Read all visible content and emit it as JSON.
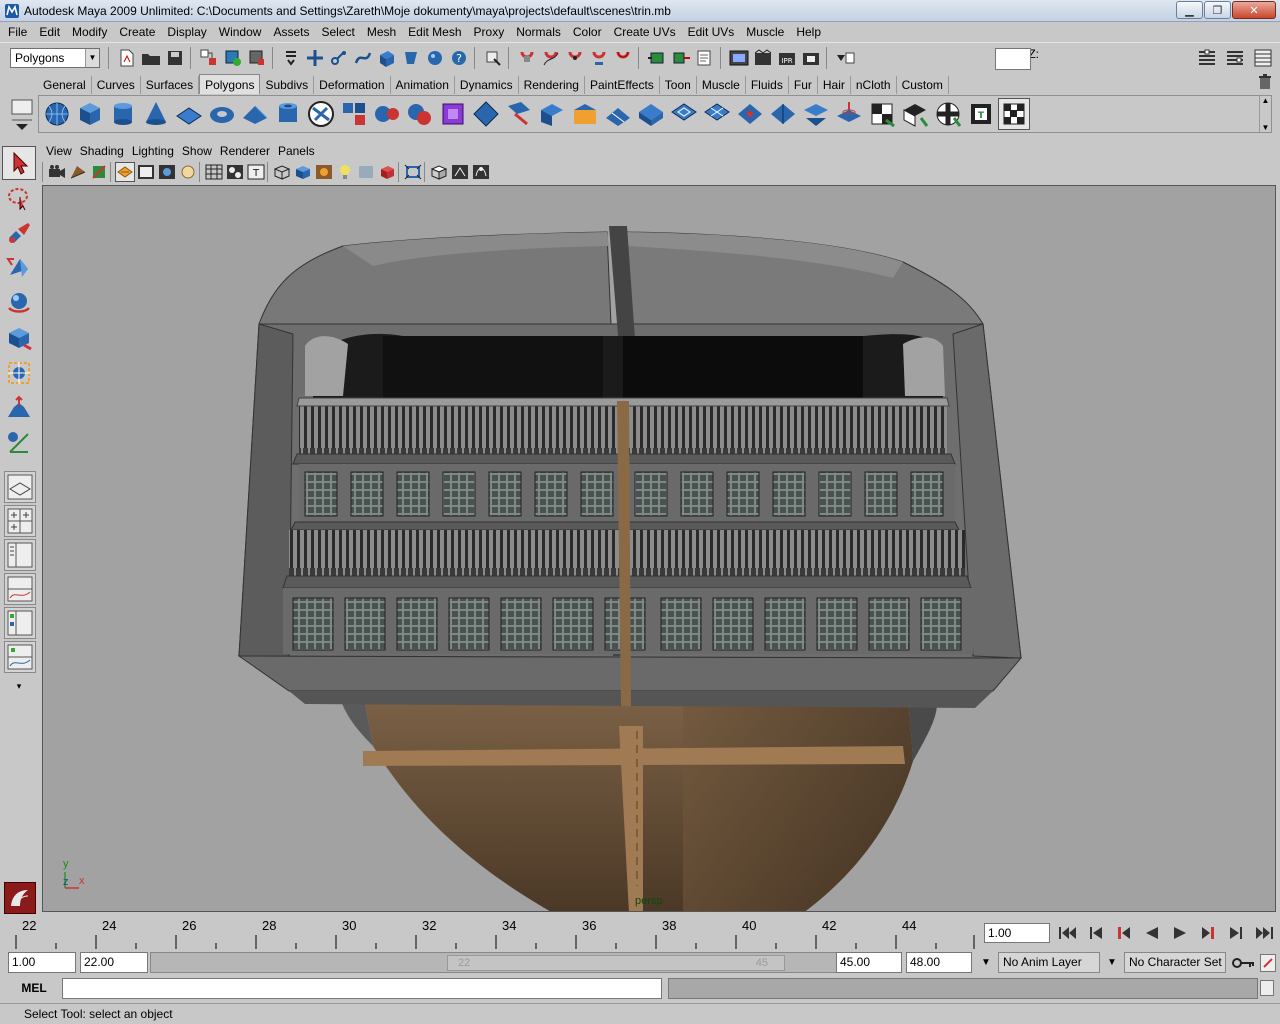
{
  "window": {
    "title": "Autodesk Maya 2009 Unlimited: C:\\Documents and Settings\\Zareth\\Moje dokumenty\\maya\\projects\\default\\scenes\\trin.mb",
    "minimize": "▁",
    "maximize": "❐",
    "close": "✕"
  },
  "menubar": [
    "File",
    "Edit",
    "Modify",
    "Create",
    "Display",
    "Window",
    "Assets",
    "Select",
    "Mesh",
    "Edit Mesh",
    "Proxy",
    "Normals",
    "Color",
    "Create UVs",
    "Edit UVs",
    "Muscle",
    "Help"
  ],
  "statusline": {
    "mode": "Polygons",
    "x_label": "X:",
    "y_label": "Y:",
    "z_label": "Z:"
  },
  "shelf_tabs": [
    "General",
    "Curves",
    "Surfaces",
    "Polygons",
    "Subdivs",
    "Deformation",
    "Animation",
    "Dynamics",
    "Rendering",
    "PaintEffects",
    "Toon",
    "Muscle",
    "Fluids",
    "Fur",
    "Hair",
    "nCloth",
    "Custom"
  ],
  "active_shelf_tab": "Polygons",
  "panel_menu": [
    "View",
    "Shading",
    "Lighting",
    "Show",
    "Renderer",
    "Panels"
  ],
  "viewport": {
    "camera": "persp",
    "axis_y": "y",
    "axis_z": "z",
    "axis_x": "x"
  },
  "timeline": {
    "ticks": [
      "22",
      "24",
      "26",
      "28",
      "30",
      "32",
      "34",
      "36",
      "38",
      "40",
      "42",
      "44"
    ],
    "current_frame": "1.00"
  },
  "range": {
    "start_time": "1.00",
    "playback_start": "22.00",
    "bar_start": "22",
    "bar_end": "45",
    "playback_end": "45.00",
    "end_time": "48.00",
    "anim_layer": "No Anim Layer",
    "character_set": "No Character Set"
  },
  "command": {
    "mel_label": "MEL"
  },
  "help_line": "Select Tool: select an object",
  "colors": {
    "viewport_bg": "#a2a2a2",
    "ui_bg": "#c8c8c8",
    "hull_wood": "#6f563b",
    "trim_wood": "#a07a52",
    "stern_gray": "#6e6e6e"
  }
}
